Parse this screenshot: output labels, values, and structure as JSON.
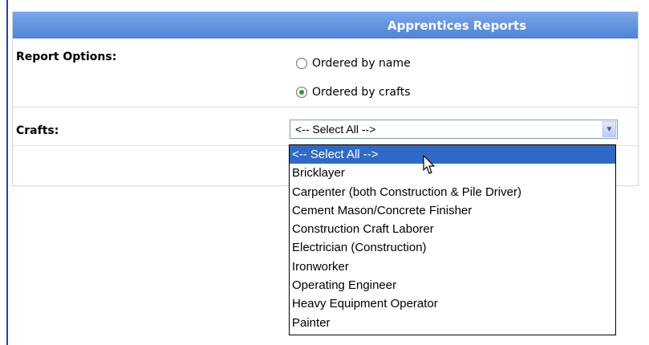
{
  "panel": {
    "header_title": "Apprentices Reports",
    "report_options_label": "Report Options:",
    "radio_options": [
      {
        "label": "Ordered by name",
        "checked": false
      },
      {
        "label": "Ordered by crafts",
        "checked": true
      }
    ],
    "crafts_label": "Crafts:"
  },
  "crafts_select": {
    "selected_value": "<-- Select All -->",
    "options": [
      "<-- Select All -->",
      "Bricklayer",
      "Carpenter (both Construction & Pile Driver)",
      "Cement Mason/Concrete Finisher",
      "Construction Craft Laborer",
      "Electrician (Construction)",
      "Ironworker",
      "Operating Engineer",
      "Heavy Equipment Operator",
      "Painter"
    ],
    "highlighted_index": 0
  },
  "icons": {
    "dropdown_arrow": "chevron-down-icon",
    "mouse_pointer": "cursor-arrow-icon"
  },
  "colors": {
    "header_bg": "#4f83d6",
    "selected_option_bg": "#316ac5",
    "radio_checked": "#1f9b3a"
  }
}
